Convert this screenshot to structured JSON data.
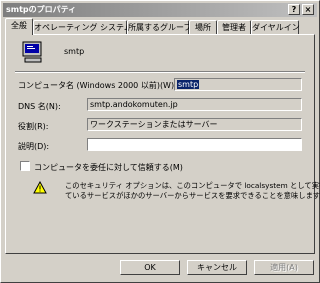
{
  "window": {
    "title": "smtpのプロパティ",
    "help_label": "?",
    "close_label": "×"
  },
  "tabs": [
    {
      "label": "全般",
      "active": true
    },
    {
      "label": "オペレーティング システム"
    },
    {
      "label": "所属するグループ"
    },
    {
      "label": "場所"
    },
    {
      "label": "管理者"
    },
    {
      "label": "ダイヤルイン"
    }
  ],
  "general": {
    "computer_name": "smtp",
    "fields": {
      "pre2000_label": "コンピュータ名 (Windows 2000 以前)(W):",
      "pre2000_value": "smtp",
      "dns_label": "DNS 名(N):",
      "dns_value": "smtp.andokomuten.jp",
      "role_label": "役割(R):",
      "role_value": "ワークステーションまたはサーバー",
      "desc_label": "説明(D):",
      "desc_value": ""
    },
    "trust_checkbox_label": "コンピュータを委任に対して信頼する(M)",
    "trust_checked": false,
    "warning_text_1": "このセキュリティ オプションは、このコンピュータで localsystem として実行し",
    "warning_text_2": "ているサービスがほかのサーバーからサービスを要求できることを意味します。"
  },
  "buttons": {
    "ok": "OK",
    "cancel": "キャンセル",
    "apply": "適用(A)"
  },
  "colors": {
    "title_start": "#7e7e7e",
    "title_end": "#c0c0c0",
    "face": "#d4d0c8",
    "selection": "#0a246a"
  }
}
